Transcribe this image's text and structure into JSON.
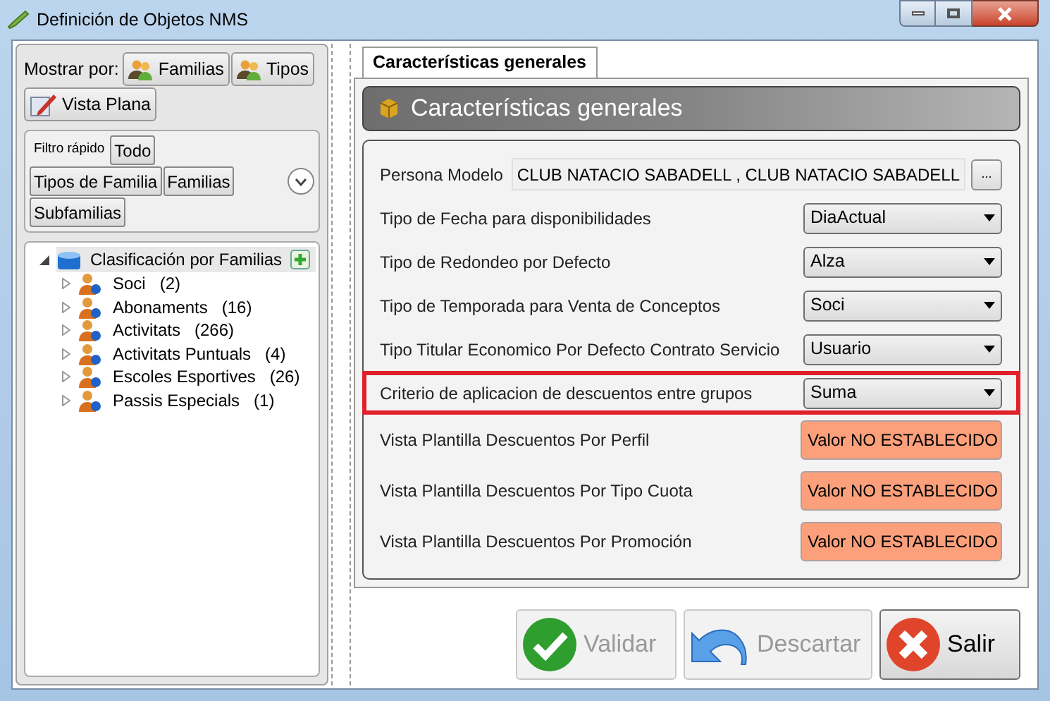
{
  "window": {
    "title": "Definición de Objetos NMS"
  },
  "left_panel": {
    "show_by_label": "Mostrar por:",
    "show_by_buttons": [
      {
        "label": "Familias"
      },
      {
        "label": "Tipos"
      },
      {
        "label": "Vista Plana"
      }
    ],
    "quick_filter": {
      "label": "Filtro rápido",
      "buttons": [
        "Todo",
        "Tipos de Familia",
        "Familias",
        "Subfamilias"
      ],
      "expanded": false
    },
    "tree": [
      {
        "label": "Clasificación por Familias",
        "expanded": true,
        "selected": true,
        "children": [
          {
            "label": "Soci",
            "count": "(2)",
            "expanded": false
          },
          {
            "label": "Abonaments",
            "count": "(16)",
            "expanded": false
          },
          {
            "label": "Activitats",
            "count": "(266)",
            "expanded": false
          },
          {
            "label": "Activitats Puntuals",
            "count": "(4)",
            "expanded": false
          },
          {
            "label": "Escoles Esportives",
            "count": "(26)",
            "expanded": false
          },
          {
            "label": "Passis Especials",
            "count": "(1)",
            "expanded": false
          }
        ]
      }
    ]
  },
  "tabs": [
    {
      "label": "Características generales",
      "selected": true
    }
  ],
  "section": {
    "title": "Características generales"
  },
  "fields": [
    {
      "kind": "text",
      "label": "Persona Modelo",
      "value": "CLUB NATACIO SABADELL , CLUB NATACIO SABADELL",
      "button": "...",
      "highlighted": false
    },
    {
      "kind": "dropdown",
      "label": "Tipo de Fecha para disponibilidades",
      "value": "DiaActual",
      "highlighted": false
    },
    {
      "kind": "dropdown",
      "label": "Tipo de Redondeo por Defecto",
      "value": "Alza",
      "highlighted": false
    },
    {
      "kind": "dropdown",
      "label": "Tipo de Temporada para Venta de Conceptos",
      "value": "Soci",
      "highlighted": false
    },
    {
      "kind": "dropdown",
      "label": "Tipo Titular Economico Por Defecto Contrato Servicio",
      "value": "Usuario",
      "highlighted": false
    },
    {
      "kind": "dropdown",
      "label": "Criterio de aplicacion de descuentos entre grupos",
      "value": "Suma",
      "highlighted": true
    },
    {
      "kind": "unset",
      "label": "Vista Plantilla Descuentos Por Perfil",
      "value": "Valor NO ESTABLECIDO",
      "highlighted": false
    },
    {
      "kind": "unset",
      "label": "Vista Plantilla Descuentos Por Tipo Cuota",
      "value": "Valor NO ESTABLECIDO",
      "highlighted": false
    },
    {
      "kind": "unset",
      "label": "Vista Plantilla Descuentos Por Promoción",
      "value": "Valor NO ESTABLECIDO",
      "highlighted": false
    }
  ],
  "buttons": [
    {
      "label": "Validar",
      "disabled": true
    },
    {
      "label": "Descartar",
      "disabled": true
    },
    {
      "label": "Salir",
      "disabled": false
    }
  ]
}
